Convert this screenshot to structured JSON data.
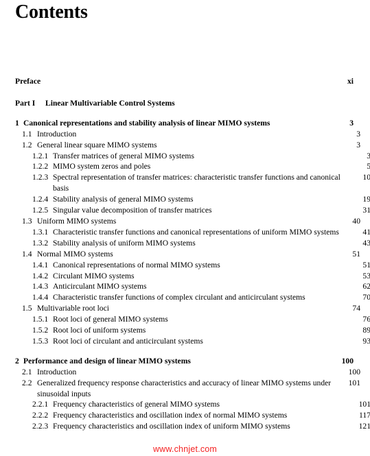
{
  "page": {
    "title": "Contents",
    "watermark": "www.chnjet.com"
  },
  "front_matter": [
    {
      "label": "Preface",
      "page": "xi"
    }
  ],
  "parts": [
    {
      "num": "Part I",
      "label": "Linear Multivariable Control Systems"
    }
  ],
  "chapters": [
    {
      "num": "1",
      "title": "Canonical representations and stability analysis of linear MIMO systems",
      "page": "3",
      "entries": [
        {
          "level": 2,
          "num": "1.1",
          "title": "Introduction",
          "page": "3"
        },
        {
          "level": 2,
          "num": "1.2",
          "title": "General linear square MIMO systems",
          "page": "3"
        },
        {
          "level": 3,
          "num": "1.2.1",
          "title": "Transfer matrices of general MIMO systems",
          "page": "3"
        },
        {
          "level": 3,
          "num": "1.2.2",
          "title": "MIMO system zeros and poles",
          "page": "5"
        },
        {
          "level": 3,
          "num": "1.2.3",
          "title": "Spectral representation of transfer matrices: characteristic transfer functions and canonical basis",
          "page": "10"
        },
        {
          "level": 3,
          "num": "1.2.4",
          "title": "Stability analysis of general MIMO systems",
          "page": "19"
        },
        {
          "level": 3,
          "num": "1.2.5",
          "title": "Singular value decomposition of transfer matrices",
          "page": "31"
        },
        {
          "level": 2,
          "num": "1.3",
          "title": "Uniform MIMO systems",
          "page": "40"
        },
        {
          "level": 3,
          "num": "1.3.1",
          "title": "Characteristic transfer functions and canonical representations of uniform MIMO systems",
          "page": "41"
        },
        {
          "level": 3,
          "num": "1.3.2",
          "title": "Stability analysis of uniform MIMO systems",
          "page": "43"
        },
        {
          "level": 2,
          "num": "1.4",
          "title": "Normal MIMO systems",
          "page": "51"
        },
        {
          "level": 3,
          "num": "1.4.1",
          "title": "Canonical representations of normal MIMO systems",
          "page": "51"
        },
        {
          "level": 3,
          "num": "1.4.2",
          "title": "Circulant MIMO systems",
          "page": "53"
        },
        {
          "level": 3,
          "num": "1.4.3",
          "title": "Anticirculant MIMO systems",
          "page": "62"
        },
        {
          "level": 3,
          "num": "1.4.4",
          "title": "Characteristic transfer functions of complex circulant and anticirculant systems",
          "page": "70"
        },
        {
          "level": 2,
          "num": "1.5",
          "title": "Multivariable root loci",
          "page": "74"
        },
        {
          "level": 3,
          "num": "1.5.1",
          "title": "Root loci of general MIMO systems",
          "page": "76"
        },
        {
          "level": 3,
          "num": "1.5.2",
          "title": "Root loci of uniform systems",
          "page": "89"
        },
        {
          "level": 3,
          "num": "1.5.3",
          "title": "Root loci of circulant and anticirculant systems",
          "page": "93"
        }
      ]
    },
    {
      "num": "2",
      "title": "Performance and design of linear MIMO systems",
      "page": "100",
      "entries": [
        {
          "level": 2,
          "num": "2.1",
          "title": "Introduction",
          "page": "100"
        },
        {
          "level": 2,
          "num": "2.2",
          "title": "Generalized frequency response characteristics and accuracy of linear MIMO systems under sinusoidal inputs",
          "page": "101"
        },
        {
          "level": 3,
          "num": "2.2.1",
          "title": "Frequency characteristics of general MIMO systems",
          "page": "101"
        },
        {
          "level": 3,
          "num": "2.2.2",
          "title": "Frequency characteristics and oscillation index of normal MIMO systems",
          "page": "117"
        },
        {
          "level": 3,
          "num": "2.2.3",
          "title": "Frequency characteristics and oscillation index of uniform MIMO systems",
          "page": "121"
        }
      ]
    }
  ]
}
